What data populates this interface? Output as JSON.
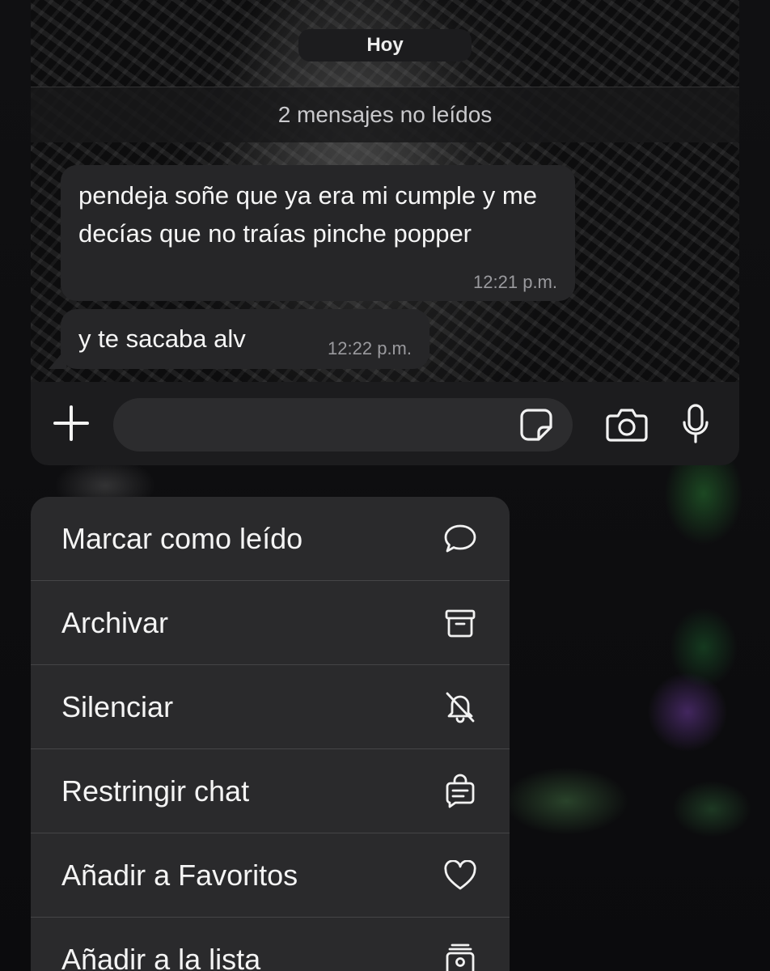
{
  "chat": {
    "date_label": "Hoy",
    "unread_label": "2 mensajes no leídos",
    "messages": [
      {
        "text": "pendeja soñe que ya era mi cumple y me decías que no traías pinche popper",
        "time": "12:21 p.m."
      },
      {
        "text": "y  te sacaba alv",
        "time": "12:22 p.m."
      }
    ]
  },
  "input_bar": {
    "attach_icon": "plus-icon",
    "message_value": "",
    "sticker_icon": "sticker-icon",
    "camera_icon": "camera-icon",
    "mic_icon": "microphone-icon"
  },
  "context_menu": {
    "items": [
      {
        "label": "Marcar como leído",
        "icon": "chat-bubble-icon"
      },
      {
        "label": "Archivar",
        "icon": "archive-box-icon"
      },
      {
        "label": "Silenciar",
        "icon": "bell-slash-icon"
      },
      {
        "label": "Restringir chat",
        "icon": "locked-chat-icon"
      },
      {
        "label": "Añadir a Favoritos",
        "icon": "heart-icon"
      },
      {
        "label": "Añadir a la lista",
        "icon": "list-add-icon"
      }
    ]
  },
  "colors": {
    "bubble": "#262628",
    "menu_background": "#2a2a2c",
    "input_bar": "#1c1c1e",
    "text_primary": "#f4f4f4",
    "text_time": "#9a9a9e"
  }
}
